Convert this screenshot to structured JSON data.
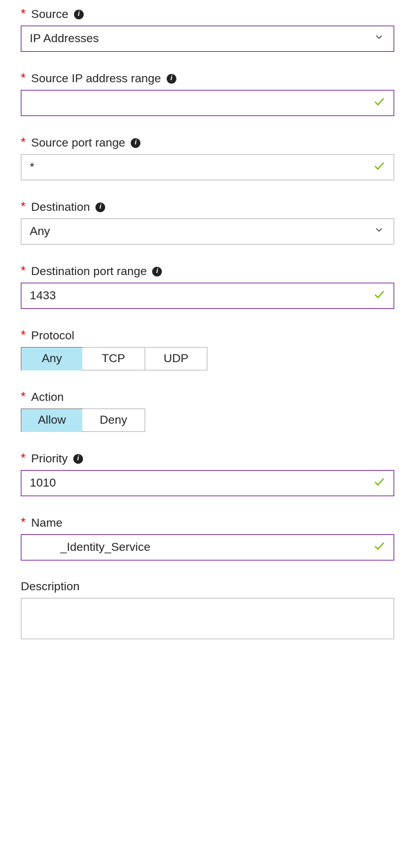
{
  "source": {
    "label": "Source",
    "value": "IP Addresses"
  },
  "source_ip_range": {
    "label": "Source IP address range",
    "value": ""
  },
  "source_port_range": {
    "label": "Source port range",
    "value": "*"
  },
  "destination": {
    "label": "Destination",
    "value": "Any"
  },
  "destination_port_range": {
    "label": "Destination port range",
    "value": "1433"
  },
  "protocol": {
    "label": "Protocol",
    "options": [
      "Any",
      "TCP",
      "UDP"
    ],
    "selected": "Any"
  },
  "action": {
    "label": "Action",
    "options": [
      "Allow",
      "Deny"
    ],
    "selected": "Allow"
  },
  "priority": {
    "label": "Priority",
    "value": "1010"
  },
  "name": {
    "label": "Name",
    "value": "_Identity_Service"
  },
  "description": {
    "label": "Description",
    "value": ""
  }
}
